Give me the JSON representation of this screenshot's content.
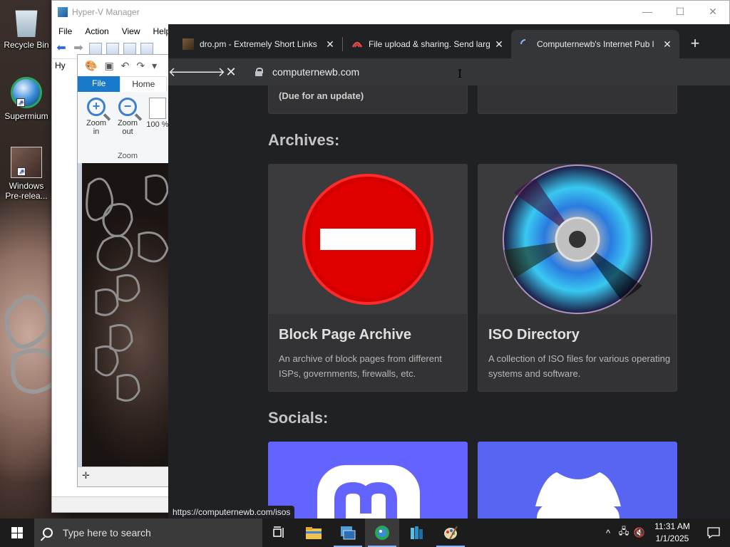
{
  "desktop": {
    "icons": [
      {
        "label": "Recycle Bin",
        "icon": "recycle-bin-icon"
      },
      {
        "label": "Supermium",
        "icon": "browser-globe-icon"
      },
      {
        "label": "Windows Pre-relea...",
        "icon": "vm-icon"
      }
    ]
  },
  "hyperv": {
    "title": "Hyper-V Manager",
    "menu": [
      "File",
      "Action",
      "View",
      "Help"
    ],
    "tree_label": "Hy",
    "controls": {
      "minimize": "—",
      "maximize": "☐",
      "close": "✕"
    }
  },
  "paint": {
    "tabs": {
      "file": "File",
      "home": "Home"
    },
    "zoom_in": "Zoom in",
    "zoom_out": "Zoom out",
    "hundred": "100 %",
    "zoom_group": "Zoom",
    "status_icon": "✛"
  },
  "browser": {
    "tabs": [
      {
        "title": "dro.pm - Extremely Short Links",
        "favicon": "dropm-favicon",
        "active": false
      },
      {
        "title": "File upload & sharing. Send larg",
        "favicon": "upload-favicon",
        "active": false
      },
      {
        "title": "Computernewb's Internet Pub l",
        "favicon": "loading-spinner",
        "active": true
      }
    ],
    "new_tab": "+",
    "address": "computernewb.com",
    "status_url": "https://computernewb.com/isos",
    "page": {
      "prev_card_text": "(Due for an update)",
      "archives_heading": "Archives:",
      "socials_heading": "Socials:",
      "cards": [
        {
          "title": "Block Page Archive",
          "desc": "An archive of block pages from different ISPs, governments, firewalls, etc.",
          "image": "no-entry-sign"
        },
        {
          "title": "ISO Directory",
          "desc": "A collection of ISO files for various operating systems and software.",
          "image": "cd-disc"
        }
      ],
      "social_cards": [
        {
          "name": "Mastodon",
          "color": "#6364ff"
        },
        {
          "name": "Discord",
          "color": "#5865f2"
        }
      ]
    }
  },
  "taskbar": {
    "search_placeholder": "Type here to search",
    "apps": [
      "task-view-icon",
      "file-explorer-icon",
      "hyperv-manager-icon",
      "supermium-icon",
      "azure-stack-icon",
      "paint-icon"
    ],
    "clock_time": "11:31 AM",
    "clock_date": "1/1/2025",
    "tray_chevron": "^"
  },
  "colors": {
    "browser_bg": "#202124",
    "card_bg": "#333335",
    "accent_file_tab": "#1979ca"
  }
}
